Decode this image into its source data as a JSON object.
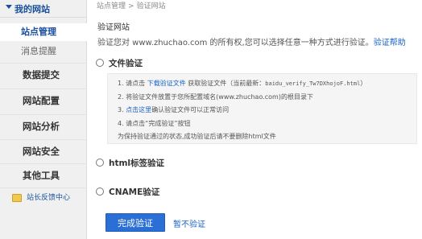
{
  "sidebar": {
    "header": "我的网站",
    "sub_items": [
      "站点管理",
      "消息提醒"
    ],
    "items": [
      "数据提交",
      "网站配置",
      "网站分析",
      "网站安全",
      "其他工具"
    ],
    "feedback": "站长反馈中心"
  },
  "breadcrumb": [
    "站点管理",
    "验证网站"
  ],
  "main": {
    "title": "验证网站",
    "desc_text": "验证您对 www.zhuchao.com 的所有权,您可以选择任意一种方式进行验证。",
    "help_link": "验证帮助"
  },
  "options": {
    "file": {
      "label": "文件验证",
      "steps": {
        "s1_prefix": "1. 请点击",
        "s1_link": "下载验证文件",
        "s1_mid": "获取验证文件（当前最新：",
        "s1_file": "baidu_verify_Tw7DXhojoF.html",
        "s1_suffix": "）",
        "s2": "2. 将验证文件放置于您所配置域名(www.zhuchao.com)的根目录下",
        "s3_prefix": "3.",
        "s3_link": "点击这里",
        "s3_suffix": "确认验证文件可以正常访问",
        "s4": "4. 请点击“完成验证”按钮",
        "note": "为保持验证通过的状态,成功验证后请不要删除html文件"
      }
    },
    "html": {
      "label": "html标签验证"
    },
    "cname": {
      "label": "CNAME验证"
    }
  },
  "actions": {
    "complete": "完成验证",
    "skip": "暂不验证"
  }
}
